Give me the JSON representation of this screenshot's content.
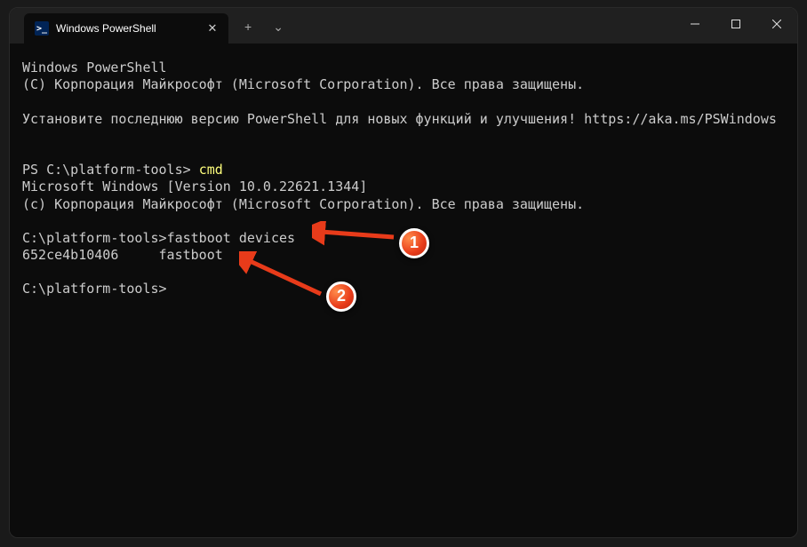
{
  "tab": {
    "title": "Windows PowerShell",
    "icon_text": ">_"
  },
  "controls": {
    "new_tab": "+",
    "dropdown": "⌄",
    "minimize": "—",
    "maximize": "☐",
    "close": "✕",
    "tab_close": "✕"
  },
  "terminal": {
    "line1": "Windows PowerShell",
    "line2": "(C) Корпорация Майкрософт (Microsoft Corporation). Все права защищены.",
    "line3": "Установите последнюю версию PowerShell для новых функций и улучшения! ",
    "link": "https://aka.ms/PSWindows",
    "ps_prompt": "PS C:\\platform-tools> ",
    "cmd1": "cmd",
    "line4": "Microsoft Windows [Version 10.0.22621.1344]",
    "line5": "(c) Корпорация Майкрософт (Microsoft Corporation). Все права защищены.",
    "prompt2": "C:\\platform-tools>",
    "cmd2": "fastboot devices",
    "output1": "652ce4b10406     fastboot",
    "prompt3": "C:\\platform-tools>"
  },
  "annotations": {
    "badge1": "1",
    "badge2": "2"
  }
}
